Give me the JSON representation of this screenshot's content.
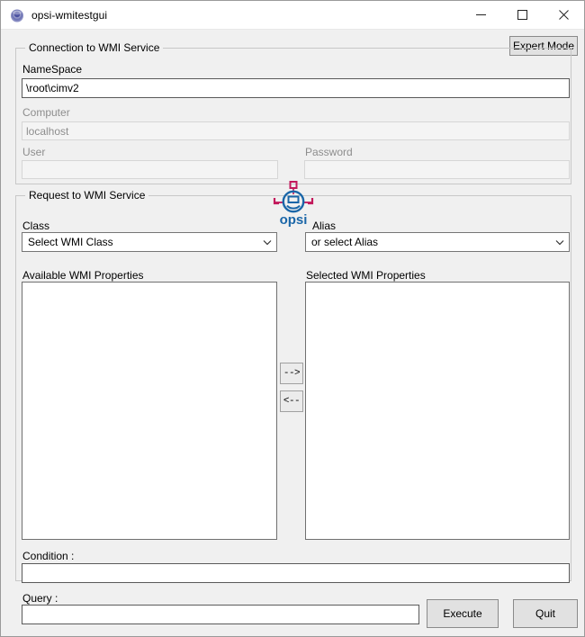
{
  "window": {
    "title": "opsi-wmitestgui",
    "icon": "opsi-app-icon",
    "controls": {
      "minimize": "minimize-icon",
      "maximize": "maximize-icon",
      "close": "close-icon"
    }
  },
  "toolbar": {
    "expert_mode_label": "Expert Mode"
  },
  "connection_group": {
    "title": "Connection to WMI Service",
    "namespace": {
      "label": "NameSpace",
      "value": "\\root\\cimv2",
      "enabled": true
    },
    "computer": {
      "label": "Computer",
      "value": "localhost",
      "enabled": false
    },
    "user": {
      "label": "User",
      "value": "",
      "enabled": false
    },
    "password": {
      "label": "Password",
      "value": "",
      "enabled": false
    }
  },
  "request_group": {
    "title": "Request to WMI Service",
    "class": {
      "label": "Class",
      "value": "Select WMI Class"
    },
    "alias": {
      "label": "Alias",
      "value": "or select Alias"
    },
    "available_properties": {
      "label": "Available WMI Properties",
      "items": []
    },
    "selected_properties": {
      "label": "Selected WMI Properties",
      "items": []
    },
    "transfer": {
      "add_label": "-->",
      "remove_label": "<--"
    },
    "condition": {
      "label": "Condition :",
      "value": ""
    }
  },
  "footer": {
    "query": {
      "label": "Query :",
      "value": ""
    },
    "execute_label": "Execute",
    "quit_label": "Quit"
  },
  "branding": {
    "logo_text": "opsi",
    "logo_blue": "#1a66a8",
    "logo_magenta": "#c2185b"
  }
}
